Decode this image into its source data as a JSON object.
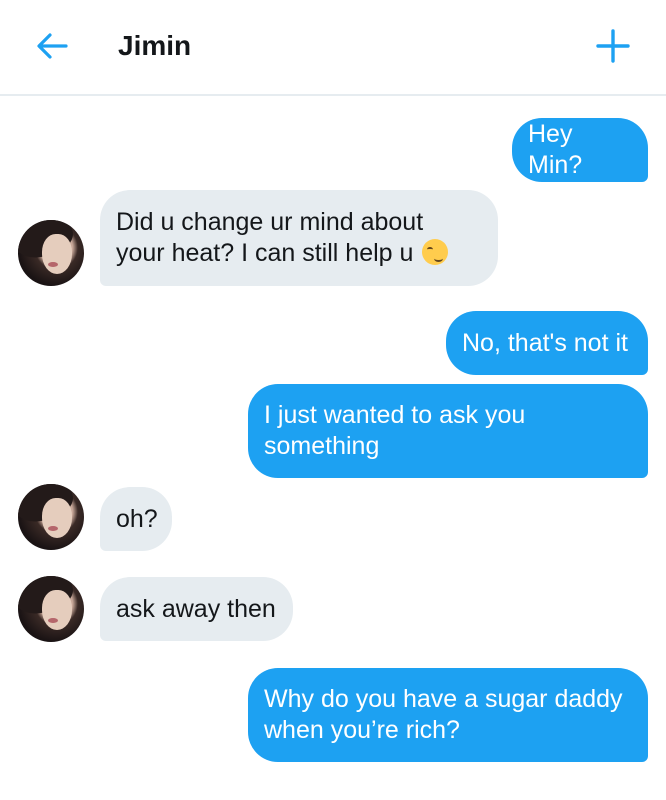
{
  "header": {
    "title": "Jimin",
    "back_icon": "arrow-left-icon",
    "add_icon": "plus-icon"
  },
  "accent": "#1da1f2",
  "messages": [
    {
      "from": "me",
      "text": "Hey Min?"
    },
    {
      "from": "them",
      "text": "Did u change ur mind about\nyour heat? I can still help u",
      "emoji": "smirking-face-emoji"
    },
    {
      "from": "me",
      "text": "No, that's not it"
    },
    {
      "from": "me",
      "text": "I just wanted to ask you\nsomething"
    },
    {
      "from": "them",
      "text": "oh?"
    },
    {
      "from": "them",
      "text": "ask away then"
    },
    {
      "from": "me",
      "text": "Why do you have a sugar daddy\nwhen you’re rich?"
    }
  ]
}
